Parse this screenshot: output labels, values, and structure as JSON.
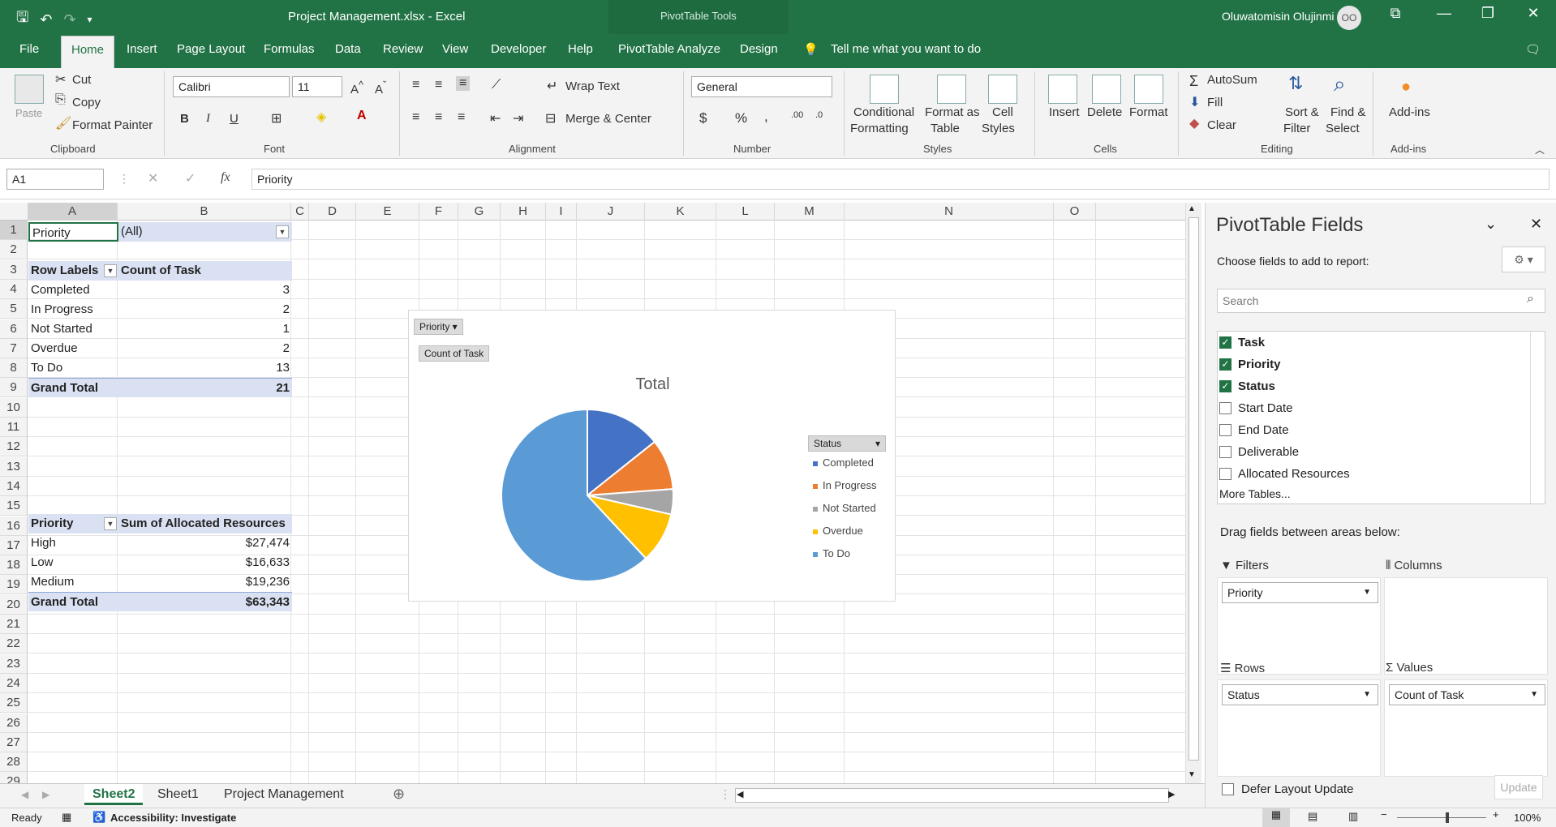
{
  "window": {
    "doc_title": "Project Management.xlsx  -  Excel",
    "context_tools": "PivotTable Tools",
    "user": "Oluwatomisin Olujinmi",
    "avatar_initials": "OO"
  },
  "tabs": [
    "File",
    "Home",
    "Insert",
    "Page Layout",
    "Formulas",
    "Data",
    "Review",
    "View",
    "Developer",
    "Help",
    "PivotTable Analyze",
    "Design"
  ],
  "tell_me": "Tell me what you want to do",
  "ribbon": {
    "clipboard": {
      "paste": "Paste",
      "cut": "Cut",
      "copy": "Copy",
      "format_painter": "Format Painter",
      "group": "Clipboard"
    },
    "font": {
      "name": "Calibri",
      "size": "11",
      "bold": "B",
      "italic": "I",
      "underline": "U",
      "group": "Font"
    },
    "alignment": {
      "wrap": "Wrap Text",
      "merge": "Merge & Center",
      "group": "Alignment"
    },
    "number": {
      "format": "General",
      "currency": "$",
      "percent": "%",
      "comma": ",",
      "group": "Number"
    },
    "styles": {
      "conditional": "Conditional",
      "formatting": "Formatting",
      "format_as": "Format as",
      "table": "Table",
      "cell": "Cell",
      "cell_styles": "Styles",
      "group": "Styles"
    },
    "cells": {
      "insert": "Insert",
      "delete": "Delete",
      "format": "Format",
      "group": "Cells"
    },
    "editing": {
      "autosum": "AutoSum",
      "fill": "Fill",
      "clear": "Clear",
      "sort": "Sort &",
      "filter": "Filter",
      "find": "Find &",
      "select": "Select",
      "group": "Editing"
    },
    "addins": {
      "label": "Add-ins",
      "group": "Add-ins"
    }
  },
  "formula_bar": {
    "name_box": "A1",
    "fx": "fx",
    "content": "Priority"
  },
  "columns": [
    "A",
    "B",
    "C",
    "D",
    "E",
    "F",
    "G",
    "H",
    "I",
    "J",
    "K",
    "L",
    "M",
    "N",
    "O"
  ],
  "rows": [
    "1",
    "2",
    "3",
    "4",
    "5",
    "6",
    "7",
    "8",
    "9",
    "10",
    "11",
    "12",
    "13",
    "14",
    "15",
    "16",
    "17",
    "18",
    "19",
    "20",
    "21",
    "22",
    "23",
    "24",
    "25",
    "26",
    "27",
    "28",
    "29"
  ],
  "pivot1": {
    "filter_label": "Priority",
    "filter_value": "(All)",
    "row_labels": "Row Labels",
    "value_header": "Count of Task",
    "rows": [
      {
        "label": "Completed",
        "value": "3"
      },
      {
        "label": "In Progress",
        "value": "2"
      },
      {
        "label": "Not Started",
        "value": "1"
      },
      {
        "label": "Overdue",
        "value": "2"
      },
      {
        "label": "To Do",
        "value": "13"
      }
    ],
    "grand_total_label": "Grand Total",
    "grand_total": "21"
  },
  "pivot2": {
    "row_header": "Priority",
    "value_header": "Sum of Allocated Resources",
    "rows": [
      {
        "label": "High",
        "value": "$27,474"
      },
      {
        "label": "Low",
        "value": "$16,633"
      },
      {
        "label": "Medium",
        "value": "$19,236"
      }
    ],
    "grand_total_label": "Grand Total",
    "grand_total": "$63,343"
  },
  "chart_data": {
    "type": "pie",
    "title": "Total",
    "filter_button": "Priority",
    "value_button": "Count of Task",
    "legend_title": "Status",
    "legend_position": "right",
    "categories": [
      "Completed",
      "In Progress",
      "Not Started",
      "Overdue",
      "To Do"
    ],
    "values": [
      3,
      2,
      1,
      2,
      13
    ],
    "colors": [
      "#4472c4",
      "#ed7d31",
      "#a5a5a5",
      "#ffc000",
      "#5b9bd5"
    ]
  },
  "sheets": {
    "active": "Sheet2",
    "others": [
      "Sheet1",
      "Project Management"
    ]
  },
  "status": {
    "ready": "Ready",
    "accessibility": "Accessibility: Investigate",
    "zoom": "100%"
  },
  "pane": {
    "title": "PivotTable Fields",
    "subtitle": "Choose fields to add to report:",
    "search_placeholder": "Search",
    "fields": [
      {
        "name": "Task",
        "checked": true
      },
      {
        "name": "Priority",
        "checked": true
      },
      {
        "name": "Status",
        "checked": true
      },
      {
        "name": "Start Date",
        "checked": false
      },
      {
        "name": "End Date",
        "checked": false
      },
      {
        "name": "Deliverable",
        "checked": false
      },
      {
        "name": "Allocated Resources",
        "checked": false
      }
    ],
    "more_tables": "More Tables...",
    "drag_hint": "Drag fields between areas below:",
    "areas": {
      "filters": {
        "label": "Filters",
        "value": "Priority"
      },
      "columns": {
        "label": "Columns"
      },
      "rows": {
        "label": "Rows",
        "value": "Status"
      },
      "values": {
        "label": "Values",
        "value": "Count of Task"
      }
    },
    "defer": "Defer Layout Update",
    "update": "Update"
  }
}
